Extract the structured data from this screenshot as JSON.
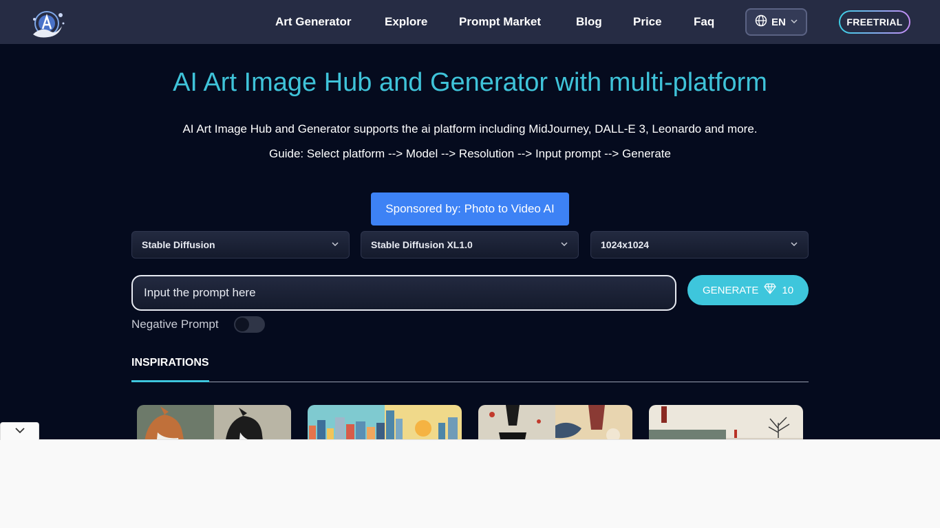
{
  "header": {
    "nav": [
      {
        "label": "Art Generator"
      },
      {
        "label": "Explore"
      },
      {
        "label": "Prompt Market"
      },
      {
        "label": "Blog"
      },
      {
        "label": "Price"
      },
      {
        "label": "Faq"
      }
    ],
    "language": "EN",
    "freetrial_label": "FREETRIAL"
  },
  "hero": {
    "title": "AI Art Image Hub and Generator with multi-platform",
    "subtitle": "AI Art Image Hub and Generator supports the ai platform including MidJourney, DALL-E 3, Leonardo and more.",
    "guide": "Guide: Select platform --> Model --> Resolution --> Input prompt --> Generate"
  },
  "sponsor_label": "Sponsored by: Photo to Video AI",
  "selects": {
    "platform": "Stable Diffusion",
    "model": "Stable Diffusion XL1.0",
    "resolution": "1024x1024"
  },
  "prompt": {
    "placeholder": "Input the prompt here"
  },
  "generate": {
    "label": "GENERATE",
    "cost": "10"
  },
  "negative_prompt": {
    "label": "Negative Prompt",
    "enabled": false
  },
  "tabs": {
    "inspirations": "INSPIRATIONS"
  },
  "colors": {
    "accent": "#3ec6dc",
    "header_bg": "#262c44",
    "page_bg": "#050b1e",
    "sponsor_blue": "#3d82f5"
  }
}
